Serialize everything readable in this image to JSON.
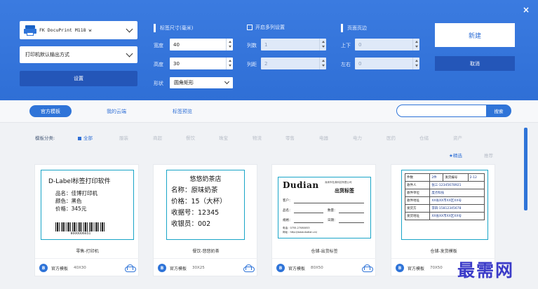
{
  "window": {
    "close_label": "×"
  },
  "printer": {
    "name": "FK DocuPrint M118 w",
    "output_mode": "打印机默认输出方式",
    "settings_label": "设置"
  },
  "label_size": {
    "title": "标签尺寸(毫米)",
    "width_label": "宽度",
    "width_value": "40",
    "height_label": "高度",
    "height_value": "30",
    "shape_label": "形状",
    "shape_value": "圆角矩形"
  },
  "multi_column": {
    "title": "开启多列设置",
    "cols_label": "列数",
    "cols_value": "1",
    "gap_label": "列距",
    "gap_value": "2"
  },
  "margins": {
    "title": "页面页边",
    "top_label": "上下",
    "top_value": "0",
    "lr_label": "左右",
    "lr_value": "0"
  },
  "actions": {
    "new_label": "新建",
    "cancel_label": "取消"
  },
  "tabs": [
    "官方模板",
    "我的云端",
    "标签预览"
  ],
  "search": {
    "placeholder": "",
    "button_label": "搜索"
  },
  "categories": {
    "label": "模板分类:",
    "items": [
      "全部",
      "服装",
      "商超",
      "餐饮",
      "珠宝",
      "物流",
      "零售",
      "电器",
      "电力",
      "医药",
      "仓储",
      "资产"
    ]
  },
  "sort": {
    "selected": "精选",
    "latest": "推荐"
  },
  "cards": [
    {
      "name": "零售-打印机",
      "source": "官方模板",
      "size": "40X30",
      "badge": "B",
      "label": {
        "title": "D-Label标签打印软件",
        "rows": [
          "品名：佳博打印机",
          "颜色：黑色",
          "价格：345元"
        ],
        "barcode": "8000006651"
      }
    },
    {
      "name": "餐饮-悠悠奶茶",
      "source": "官方模板",
      "size": "30X25",
      "badge": "B",
      "label": {
        "title": "悠悠奶茶店",
        "rows": [
          "名称：原味奶茶",
          "价格：15（大杯）",
          "收据号：12345",
          "收银员：002"
        ]
      }
    },
    {
      "name": "仓储-出货标签",
      "source": "官方模板",
      "size": "80X50",
      "badge": "B",
      "label": {
        "logo": "Dudian",
        "subtitle": "出货标签",
        "company": "深圳市杜典科技有限公司",
        "fields": [
          "客户：",
          "品名：",
          "数量：",
          "规格：",
          "日期："
        ],
        "phone": "电话：0755-27080053",
        "web": "网址：http://www.dudian.cn/"
      }
    },
    {
      "name": "仓储-发货模板",
      "source": "官方模板",
      "size": "70X50",
      "badge": "B",
      "label": {
        "rows": [
          [
            "件数",
            "2件",
            "发货编号",
            "2-12"
          ],
          [
            "收件人",
            "张三-12345678921"
          ],
          [
            "收件单位",
            "度点科技"
          ],
          [
            "收件地址",
            "XX省XX市XX区XX号"
          ],
          [
            "发货方",
            "李四-15812345678"
          ],
          [
            "发货地址",
            "XX省XX市XX区XX号"
          ]
        ]
      }
    }
  ],
  "watermark": "最需网"
}
